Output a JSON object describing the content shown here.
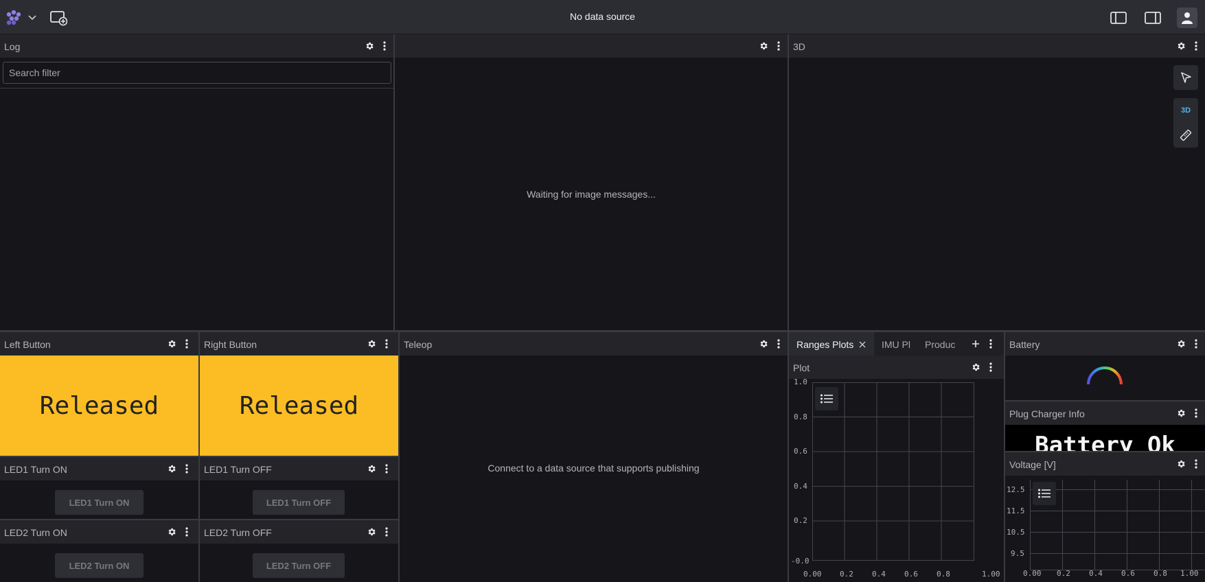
{
  "topbar": {
    "title": "No data source",
    "icons": [
      "app-logo",
      "chevron-down",
      "add-panel",
      "left-sidebar-toggle",
      "right-sidebar-toggle",
      "user-account"
    ]
  },
  "log_panel": {
    "title": "Log",
    "search_placeholder": "Search filter"
  },
  "image_panel": {
    "title": "",
    "message": "Waiting for image messages..."
  },
  "three_d_panel": {
    "title": "3D",
    "toolbar": {
      "mode_label": "3D"
    }
  },
  "left_button": {
    "title": "Left Button",
    "state": "Released"
  },
  "right_button": {
    "title": "Right Button",
    "state": "Released"
  },
  "led1_on": {
    "title": "LED1 Turn ON",
    "button_label": "LED1 Turn ON"
  },
  "led1_off": {
    "title": "LED1 Turn OFF",
    "button_label": "LED1 Turn OFF"
  },
  "led2_on": {
    "title": "LED2 Turn ON",
    "button_label": "LED2 Turn ON"
  },
  "led2_off": {
    "title": "LED2 Turn OFF",
    "button_label": "LED2 Turn OFF"
  },
  "teleop": {
    "title": "Teleop",
    "message": "Connect to a data source that supports publishing"
  },
  "tab_panel": {
    "tabs": [
      "Ranges Plots",
      "IMU Pl",
      "Produc"
    ],
    "active_tab": "Ranges Plots"
  },
  "plot_panel": {
    "title": "Plot",
    "y_ticks": [
      "1.0",
      "0.8",
      "0.6",
      "0.4",
      "0.2",
      "-0.0"
    ],
    "x_ticks": [
      "0.00",
      "0.2",
      "0.4",
      "0.6",
      "0.8",
      "1.00"
    ]
  },
  "battery_panel": {
    "title": "Battery"
  },
  "plug_charger": {
    "title": "Plug Charger Info",
    "text": "Battery Ok"
  },
  "voltage_panel": {
    "title": "Voltage [V]",
    "y_ticks": [
      "12.5",
      "11.5",
      "10.5",
      "9.5"
    ],
    "x_ticks": [
      "0.00",
      "0.2",
      "0.4",
      "0.6",
      "0.8",
      "1.00"
    ]
  },
  "colors": {
    "released_bg": "#fcbd24",
    "accent": "#4fb8f0",
    "logo": "#8f7fe8"
  }
}
